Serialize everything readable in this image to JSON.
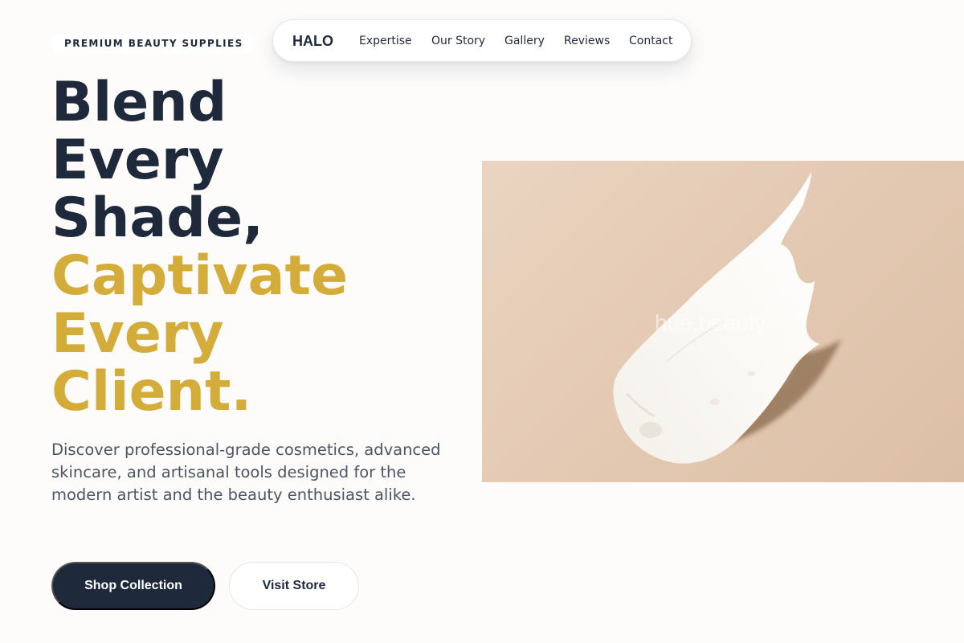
{
  "eyebrow": "PREMIUM BEAUTY SUPPLIES",
  "nav": {
    "brand": "HALO",
    "links": [
      "Expertise",
      "Our Story",
      "Gallery",
      "Reviews",
      "Contact"
    ]
  },
  "hero": {
    "headline_dark": [
      "Blend",
      "Every",
      "Shade,"
    ],
    "headline_accent": [
      "Captivate",
      "Every",
      "Client."
    ],
    "description": "Discover professional-grade cosmetics, advanced skincare, and artisanal tools designed for the modern artist and the beauty enthusiast alike.",
    "primary_button": "Shop Collection",
    "secondary_button": "Visit Store",
    "image_watermark": "hue.beauty"
  },
  "colors": {
    "primary": "#1e293b",
    "accent": "#d4ac3a",
    "background": "#fdfcfb",
    "muted_text": "#4b5563"
  }
}
